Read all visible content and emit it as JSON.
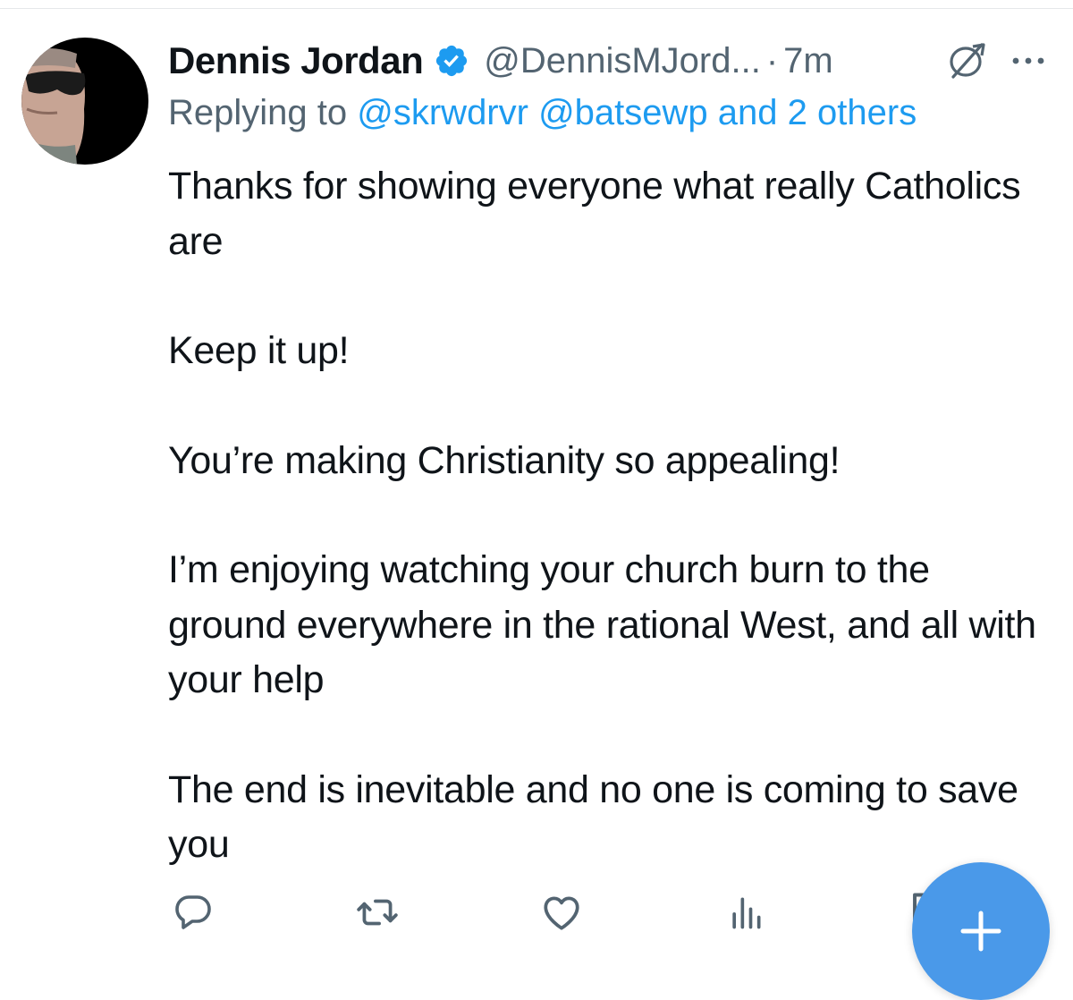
{
  "tweet": {
    "author": {
      "display_name": "Dennis Jordan",
      "handle": "@DennisMJord...",
      "verified": true,
      "avatar": "profile-photo"
    },
    "separator": "·",
    "timestamp": "7m",
    "reply_prefix": "Replying to",
    "reply_to": [
      "@skrwdrvr",
      "@batsewp"
    ],
    "reply_joiner": "and",
    "reply_others": "2 others",
    "paragraphs": [
      "Thanks for showing everyone what really Catholics are",
      "Keep it up!",
      "You’re making Christianity so appealing!",
      "I’m enjoying watching your church burn to the ground everywhere in the rational West, and all with your help",
      "The end is inevitable and no one is coming to save you"
    ]
  },
  "icons": {
    "verified": "verified-badge-icon",
    "grok": "grok-icon",
    "more": "more-icon",
    "reply": "reply-icon",
    "retweet": "retweet-icon",
    "like": "heart-icon",
    "views": "views-icon",
    "bookmark": "bookmark-icon",
    "compose": "compose-plus-icon"
  },
  "colors": {
    "link": "#1d9bf0",
    "secondary_text": "#536471",
    "primary_text": "#0f1419",
    "fab": "#4a99e9"
  }
}
